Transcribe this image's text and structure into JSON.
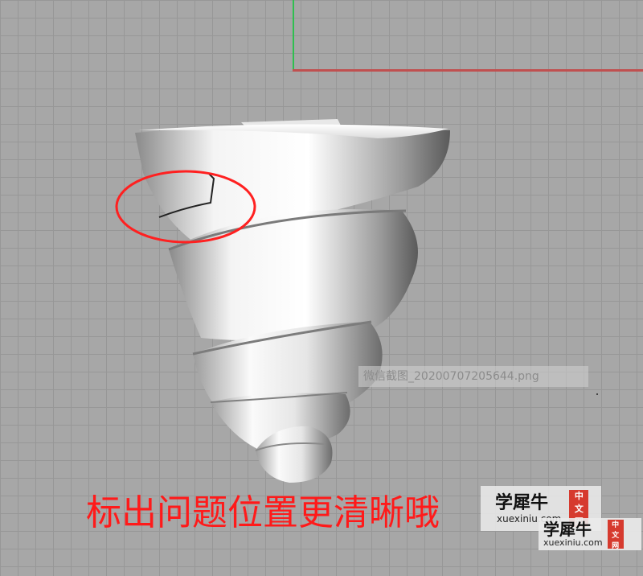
{
  "viewport": {
    "background_color": "#a7a7a7",
    "grid_color": "#979797",
    "y_axis_color": "#2fbf4f",
    "x_axis_color": "#c05050"
  },
  "file_label": "微信截图_20200707205644.png",
  "caption": "标出问题位置更清晰哦",
  "caption_color": "#ff1a1a",
  "annotation_color": "#ff2020",
  "watermark": {
    "name": "学犀牛",
    "url": "xuexiniu.com",
    "seal_chars": [
      "中",
      "文",
      "网"
    ]
  },
  "model": {
    "icon": "spiral-shell-shape"
  }
}
